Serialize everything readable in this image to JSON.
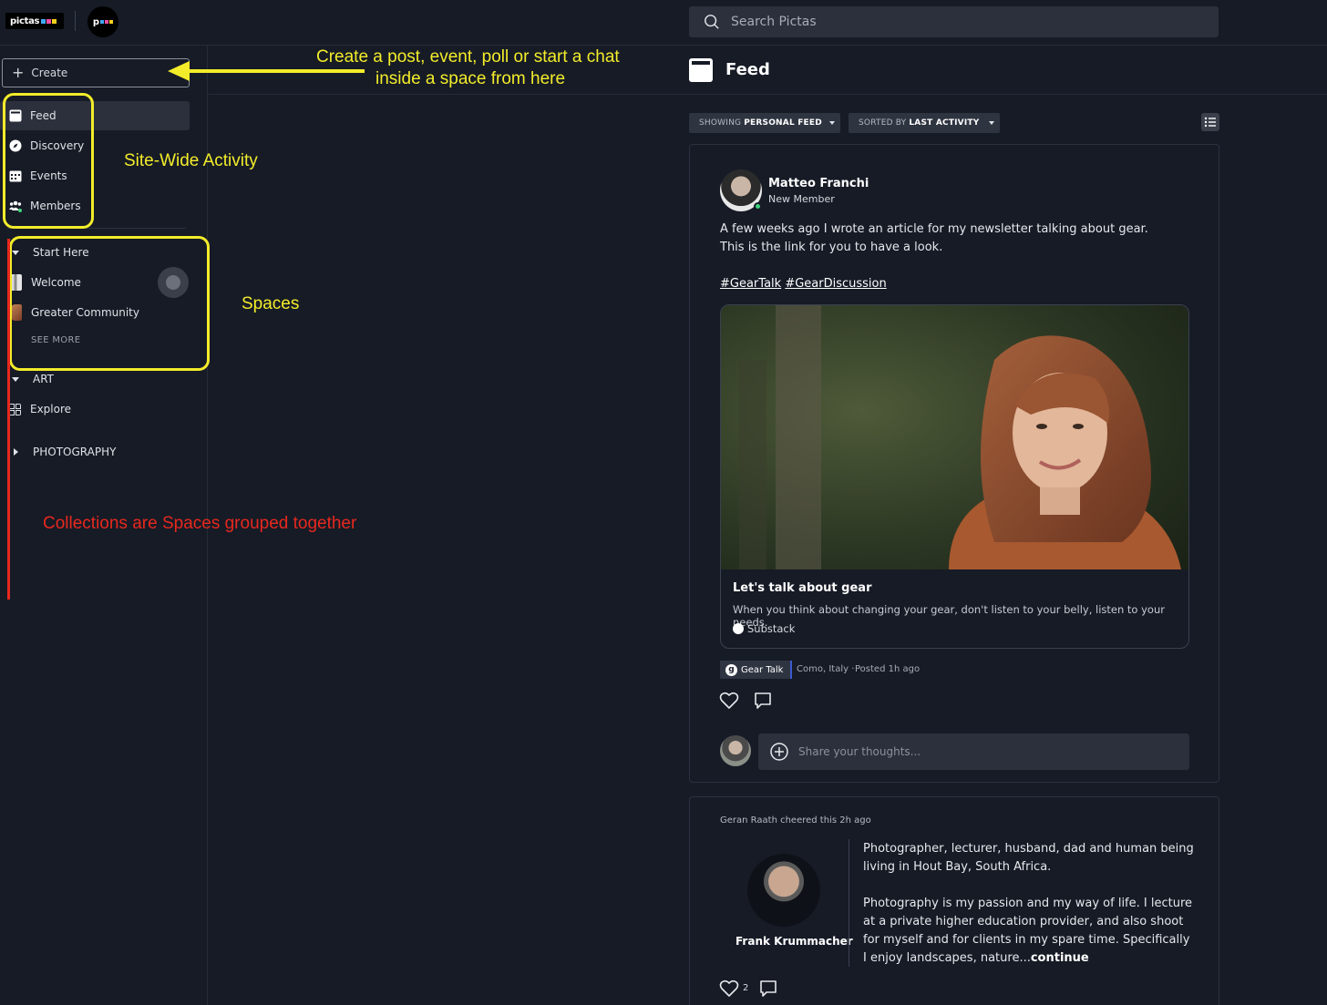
{
  "topbar": {
    "brand": "pictas",
    "brand_short": "p",
    "search_placeholder": "Search Pictas"
  },
  "sidebar": {
    "create_label": "Create",
    "nav": [
      {
        "label": "Feed",
        "icon": "feed-icon",
        "active": true
      },
      {
        "label": "Discovery",
        "icon": "compass-icon"
      },
      {
        "label": "Events",
        "icon": "calendar-icon"
      },
      {
        "label": "Members",
        "icon": "members-icon"
      }
    ],
    "collections": [
      {
        "label": "Start Here",
        "expanded": true
      },
      {
        "label": "ART",
        "expanded": true
      },
      {
        "label": "PHOTOGRAPHY",
        "expanded": false
      }
    ],
    "spaces": [
      {
        "label": "Welcome"
      },
      {
        "label": "Greater Community"
      },
      {
        "label": "Explore"
      }
    ],
    "see_more": "SEE MORE"
  },
  "annotations": {
    "create_note_line1": "Create a post, event, poll or start a chat",
    "create_note_line2": "inside a space from here",
    "site_wide": "Site-Wide Activity",
    "spaces": "Spaces",
    "collections": "Collections are Spaces grouped together",
    "yellow": "#f3ec2a",
    "red": "#e8281e"
  },
  "feed": {
    "title": "Feed",
    "filter_show_prefix": "SHOWING",
    "filter_show_value": "PERSONAL FEED",
    "filter_sort_prefix": "SORTED BY",
    "filter_sort_value": "LAST ACTIVITY"
  },
  "post1": {
    "author": "Matteo Franchi",
    "role": "New Member",
    "line1": "A few weeks ago I wrote an article for my newsletter talking about gear.",
    "line2": "This is the link for you to have a look.",
    "tag1": "#GearTalk",
    "tag2": "#GearDiscussion",
    "link_title": "Let's talk about gear",
    "link_desc": "When you think about changing your gear, don't listen to your belly, listen to your needs.",
    "link_source": "Substack",
    "space": "Gear Talk",
    "location": "Como, Italy ·",
    "posted": "Posted 1h ago",
    "comment_placeholder": "Share your thoughts..."
  },
  "post2": {
    "cheer": "Geran Raath cheered this 2h ago",
    "name": "Frank Krummacher",
    "bio_p1": "Photographer, lecturer, husband, dad and human being living in Hout Bay, South Africa.",
    "bio_p2": "Photography is my passion and my way of life. I lecture at a private higher education provider, and also shoot for myself and for clients in my spare time. Specifically I enjoy landscapes, nature...",
    "continue": "continue",
    "likes": "2"
  }
}
